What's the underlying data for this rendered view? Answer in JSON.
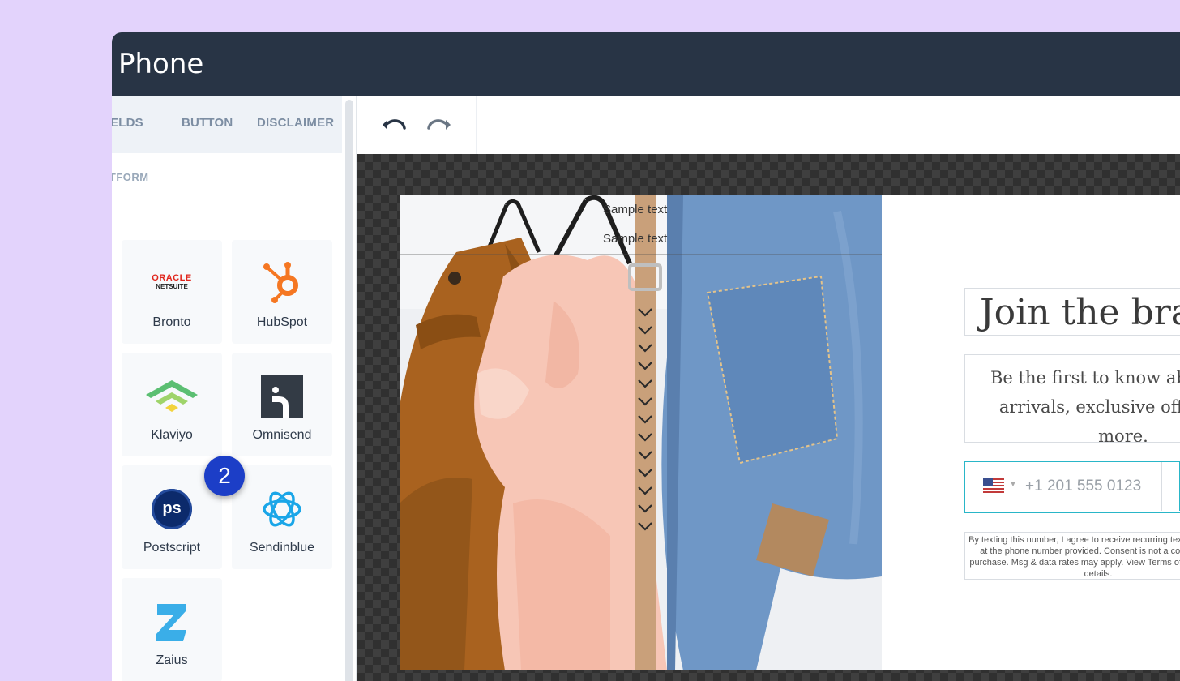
{
  "window": {
    "title": "Phone"
  },
  "sidebar": {
    "tabs": [
      {
        "label": "ELDS"
      },
      {
        "label": "BUTTON"
      },
      {
        "label": "DISCLAIMER"
      }
    ],
    "section_label": "ATFORM",
    "integrations": [
      {
        "label": "Bronto",
        "icon": "oracle-netsuite-logo",
        "logo_text": [
          "ORACLE",
          "NETSUITE"
        ]
      },
      {
        "label": "HubSpot",
        "icon": "hubspot-logo"
      },
      {
        "label": "Klaviyo",
        "icon": "klaviyo-logo"
      },
      {
        "label": "Omnisend",
        "icon": "omnisend-logo"
      },
      {
        "label": "Postscript",
        "icon": "postscript-logo",
        "logo_text": "ps"
      },
      {
        "label": "Sendinblue",
        "icon": "sendinblue-logo"
      },
      {
        "label": "Zaius",
        "icon": "zaius-logo"
      }
    ]
  },
  "step_badge": "2",
  "toolbar": {
    "undo_icon": "undo-icon",
    "redo_icon": "redo-icon"
  },
  "popup": {
    "sample_texts": [
      "Sample text",
      "Sample text"
    ],
    "headline": "Join the brand",
    "subtitle": "Be the first to know about new arrivals, exclusive offers and more.",
    "phone": {
      "placeholder": "+1 201 555 0123",
      "country": "US"
    },
    "disclaimer": "By texting this number, I agree to receive recurring text messages at the phone number provided. Consent is not a condition to purchase. Msg & data rates may apply. View Terms of Service for details."
  },
  "colors": {
    "background": "#e3d3fc",
    "titlebar": "#283445",
    "accent": "#29b6c8",
    "badge": "#1c3ec7"
  }
}
